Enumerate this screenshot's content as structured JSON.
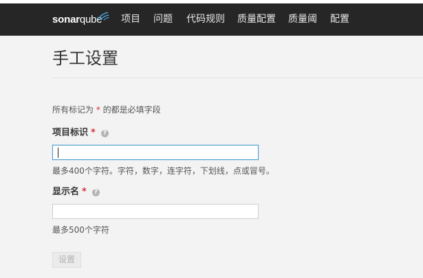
{
  "nav": {
    "logo": {
      "part1": "sonar",
      "part2": "qube"
    },
    "items": [
      {
        "label": "项目"
      },
      {
        "label": "问题"
      },
      {
        "label": "代码规则"
      },
      {
        "label": "质量配置"
      },
      {
        "label": "质量阈"
      },
      {
        "label": "配置"
      }
    ]
  },
  "page": {
    "title": "手工设置",
    "required_note": {
      "prefix": "所有标记为 ",
      "star": "*",
      "suffix": " 的都是必填字段"
    }
  },
  "form": {
    "project_key": {
      "label": "项目标识",
      "star": "*",
      "help_icon": "question-circle-icon",
      "value": "",
      "hint": "最多400个字符。字符，数字，连字符，下划线，点或冒号。"
    },
    "display_name": {
      "label": "显示名",
      "star": "*",
      "help_icon": "question-circle-icon",
      "value": "",
      "hint": "最多500个字符"
    },
    "submit_label": "设置"
  },
  "colors": {
    "navbar": "#262626",
    "background": "#f3f3f3",
    "required_star": "#d02f3a",
    "focus_border": "#4b9fd5"
  }
}
